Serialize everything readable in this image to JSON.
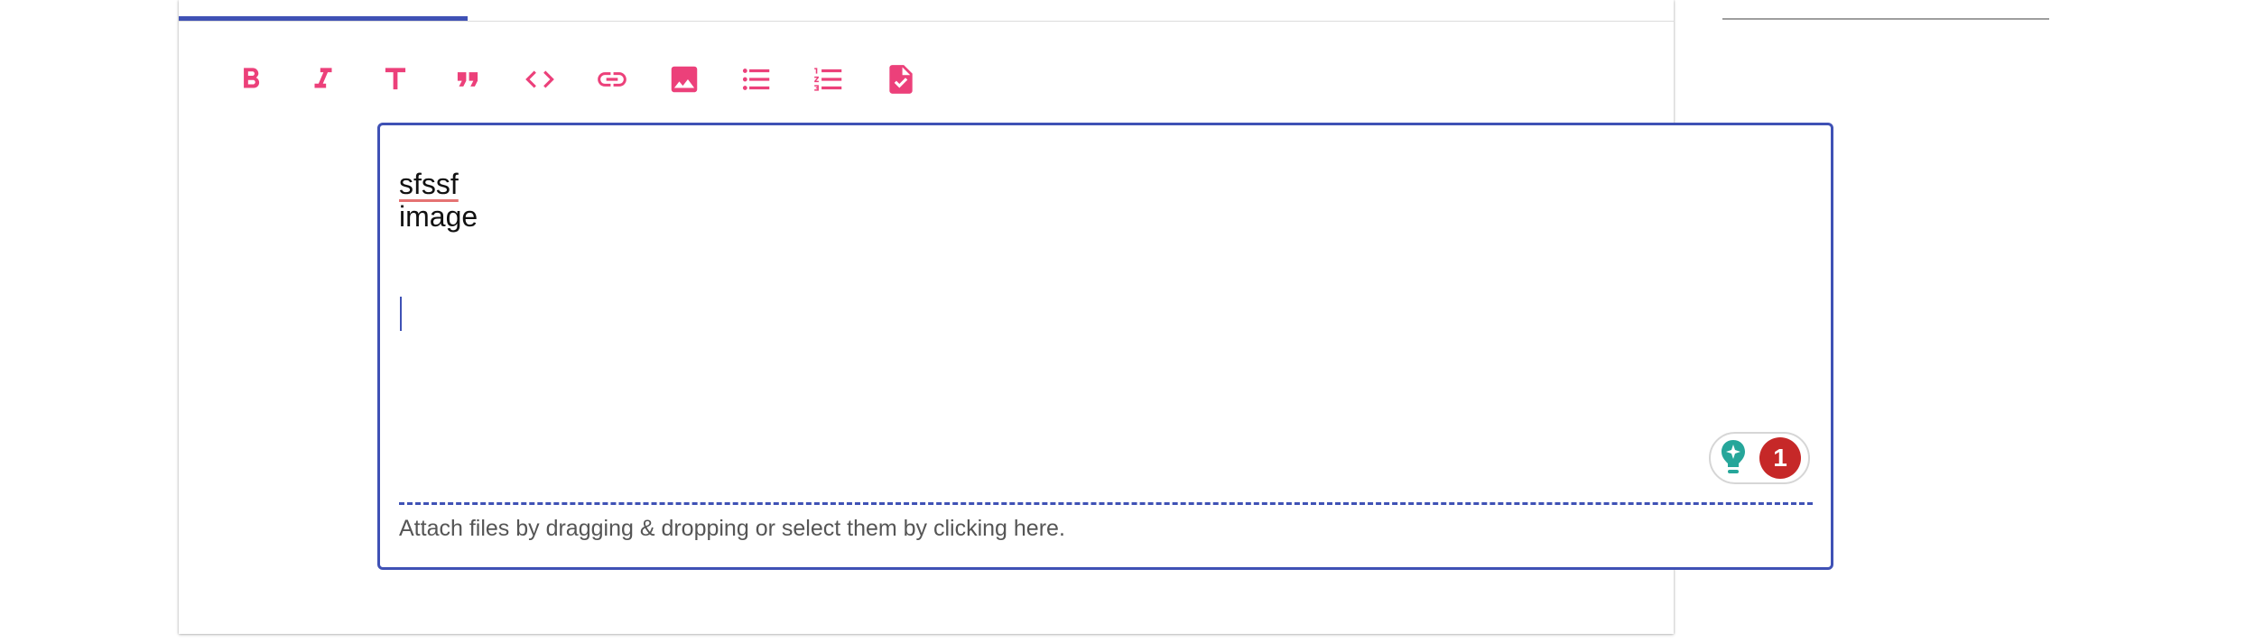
{
  "toolbar": {
    "buttons": [
      {
        "name": "bold",
        "icon": "bold-icon"
      },
      {
        "name": "italic",
        "icon": "italic-icon"
      },
      {
        "name": "heading",
        "icon": "heading-icon"
      },
      {
        "name": "quote",
        "icon": "quote-icon"
      },
      {
        "name": "code",
        "icon": "code-icon"
      },
      {
        "name": "link",
        "icon": "link-icon"
      },
      {
        "name": "image",
        "icon": "image-icon"
      },
      {
        "name": "bulleted-list",
        "icon": "bulleted-list-icon"
      },
      {
        "name": "numbered-list",
        "icon": "numbered-list-icon"
      },
      {
        "name": "task-list",
        "icon": "task-list-icon"
      }
    ],
    "icon_color": "#ec407a"
  },
  "editor": {
    "lines": [
      "sfssf",
      "image"
    ],
    "attach_hint": "Attach files by dragging & dropping or select them by clicking here.",
    "border_color": "#3f51b5"
  },
  "grammar_widget": {
    "icon": "lightbulb-icon",
    "issue_count": "1",
    "badge_color": "#c62828"
  },
  "tabs": {
    "accent_color": "#3f51b5"
  }
}
